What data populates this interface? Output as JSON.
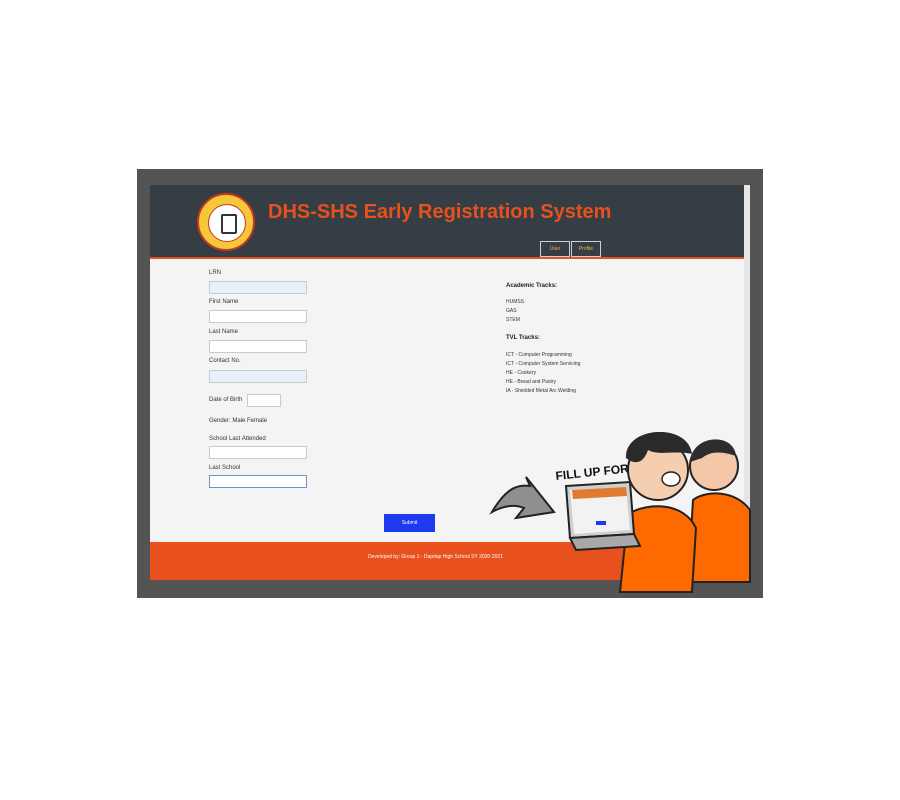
{
  "app": {
    "title": "DHS-SHS Early Registration System",
    "header_buttons": [
      "User",
      "Profile"
    ]
  },
  "form": {
    "fields": [
      {
        "label": "LRN",
        "value": "",
        "style": "filled"
      },
      {
        "label": "First Name",
        "value": "",
        "style": "plain"
      },
      {
        "label": "Last Name",
        "value": "",
        "style": "plain"
      },
      {
        "label": "Contact No.",
        "value": "",
        "style": "filled"
      }
    ],
    "birth_label": "Date of Birth",
    "birth_value": "",
    "gender_label": "Gender:  Male  Female",
    "extra_fields": [
      {
        "label": "School Last Attended",
        "value": ""
      },
      {
        "label": "Last School",
        "value": ""
      }
    ],
    "submit_label": "Submit"
  },
  "tracks": {
    "academic_title": "Academic Tracks:",
    "academic": [
      "HUMSS",
      "GAS",
      "STEM"
    ],
    "tvl_title": "TVL Tracks:",
    "tvl": [
      "ICT - Computer Programming",
      "ICT - Computer System Servicing",
      "HE - Cookery",
      "HE - Bread and Pastry",
      "IA - Shielded Metal Arc Welding"
    ]
  },
  "footer": {
    "text": "Developed by: Group 1 - Dapdap High School SY 2020-2021"
  },
  "illustration": {
    "caption": "FILL UP FORM"
  },
  "colors": {
    "header": "#343e44",
    "accent": "#e8501e",
    "button": "#1d3af0"
  }
}
